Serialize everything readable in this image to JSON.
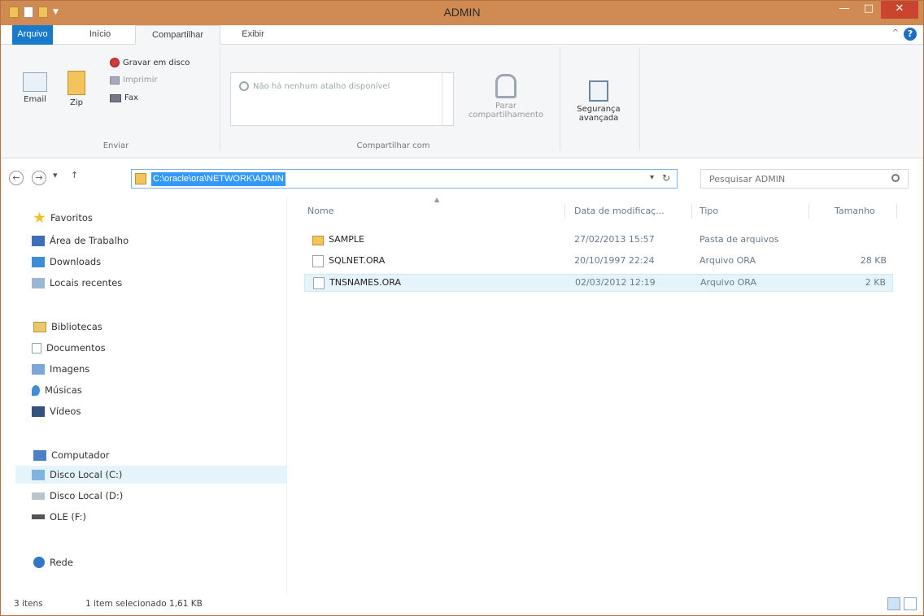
{
  "window": {
    "title": "ADMIN"
  },
  "ribbon_tabs": [
    {
      "label": "Arquivo"
    },
    {
      "label": "Início"
    },
    {
      "label": "Compartilhar"
    },
    {
      "label": "Exibir"
    }
  ],
  "ribbon": {
    "email": "Email",
    "zip": "Zip",
    "gravar": "Gravar em disco",
    "imprimir": "Imprimir",
    "fax": "Fax",
    "enviar_label": "Enviar",
    "no_share": "Não há nenhum atalho disponível",
    "parar": "Parar compartilhamento",
    "compart_label": "Compartilhar com",
    "seguranca": "Segurança avançada"
  },
  "address": {
    "path": "C:\\oracle\\ora\\NETWORK\\ADMIN",
    "search_placeholder": "Pesquisar ADMIN"
  },
  "nav": {
    "favoritos": "Favoritos",
    "area_trabalho": "Área de Trabalho",
    "downloads": "Downloads",
    "locais": "Locais recentes",
    "bibliotecas": "Bibliotecas",
    "documentos": "Documentos",
    "imagens": "Imagens",
    "musicas": "Músicas",
    "videos": "Vídeos",
    "computador": "Computador",
    "disco_c": "Disco Local (C:)",
    "disco_d": "Disco Local (D:)",
    "ole": "OLE (F:)",
    "rede": "Rede"
  },
  "columns": {
    "name": "Nome",
    "date": "Data de modificaç...",
    "type": "Tipo",
    "size": "Tamanho"
  },
  "files": [
    {
      "name": "SAMPLE",
      "date": "27/02/2013 15:57",
      "type": "Pasta de arquivos",
      "size": ""
    },
    {
      "name": "SQLNET.ORA",
      "date": "20/10/1997 22:24",
      "type": "Arquivo ORA",
      "size": "28 KB"
    },
    {
      "name": "TNSNAMES.ORA",
      "date": "02/03/2012 12:19",
      "type": "Arquivo ORA",
      "size": "2 KB"
    }
  ],
  "status": {
    "items": "3 itens",
    "selected": "1 item selecionado  1,61 KB"
  }
}
